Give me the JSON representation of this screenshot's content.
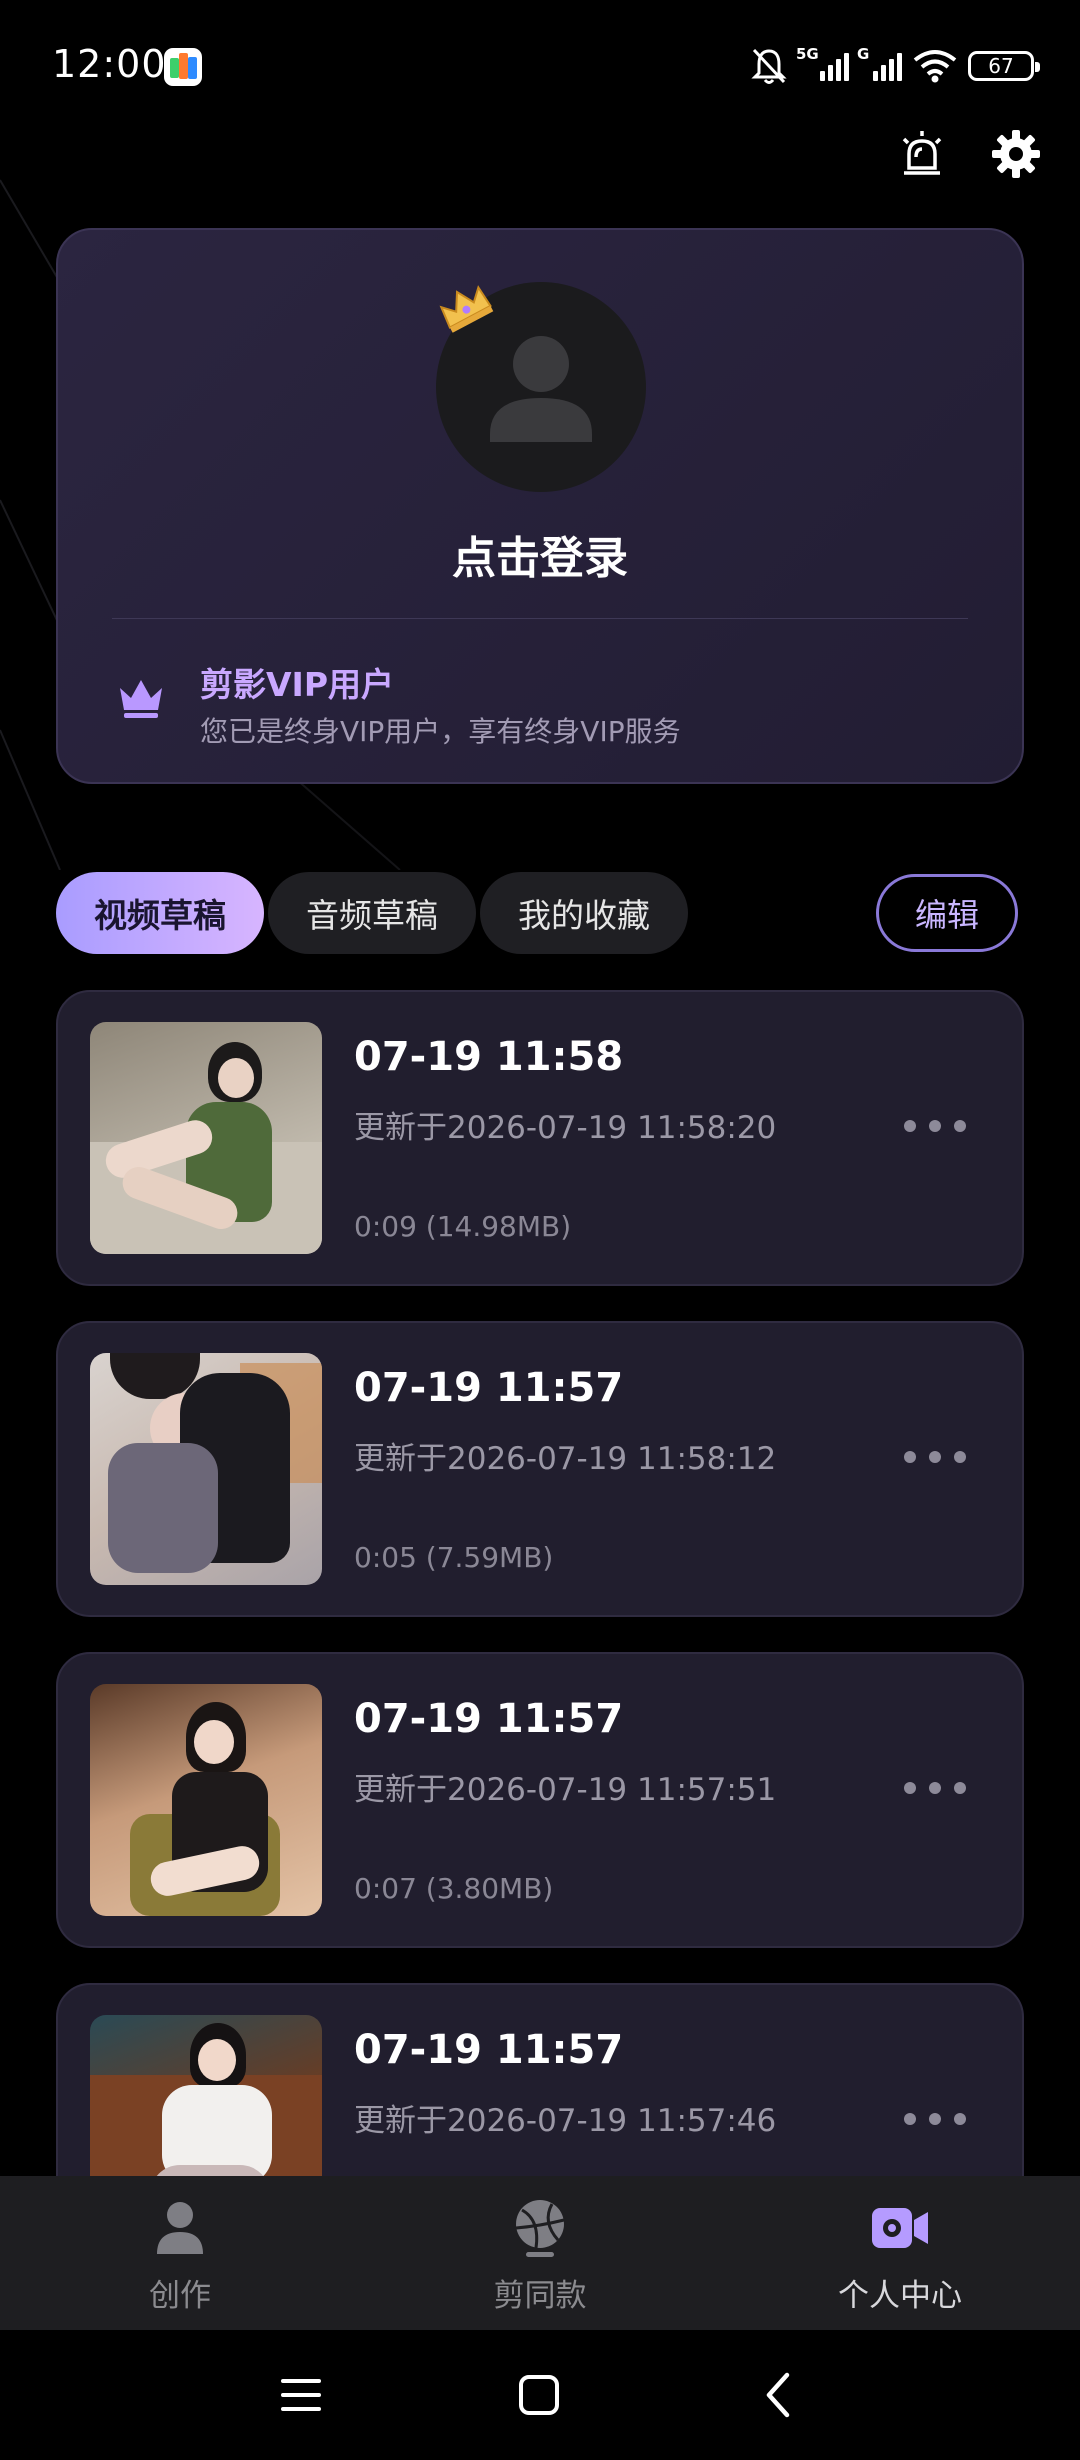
{
  "status_bar": {
    "time": "12:00",
    "network_1": "5G",
    "network_2": "G",
    "battery": "67"
  },
  "top_actions": {
    "alert_icon": "siren-alert-icon",
    "settings_icon": "gear-icon"
  },
  "profile": {
    "login_label": "点击登录",
    "vip_title": "剪影VIP用户",
    "vip_desc": "您已是终身VIP用户，享有终身VIP服务"
  },
  "tabs": [
    {
      "label": "视频草稿",
      "active": true
    },
    {
      "label": "音频草稿",
      "active": false
    },
    {
      "label": "我的收藏",
      "active": false
    }
  ],
  "edit_label": "编辑",
  "drafts": [
    {
      "title": "07-19 11:58",
      "updated": "更新于2026-07-19 11:58:20",
      "meta": "0:09 (14.98MB)"
    },
    {
      "title": "07-19 11:57",
      "updated": "更新于2026-07-19 11:58:12",
      "meta": "0:05 (7.59MB)"
    },
    {
      "title": "07-19 11:57",
      "updated": "更新于2026-07-19 11:57:51",
      "meta": "0:07 (3.80MB)"
    },
    {
      "title": "07-19 11:57",
      "updated": "更新于2026-07-19 11:57:46",
      "meta": ""
    }
  ],
  "bottom_nav": [
    {
      "label": "创作",
      "icon": "person-icon",
      "active": false
    },
    {
      "label": "剪同款",
      "icon": "template-ball-icon",
      "active": false
    },
    {
      "label": "个人中心",
      "icon": "video-camera-icon",
      "active": true
    }
  ],
  "colors": {
    "accent_purple": "#c9a8ff",
    "tab_gradient_start": "#a99cff",
    "tab_gradient_end": "#d7b5ff",
    "card_bg": "#211e2e"
  }
}
